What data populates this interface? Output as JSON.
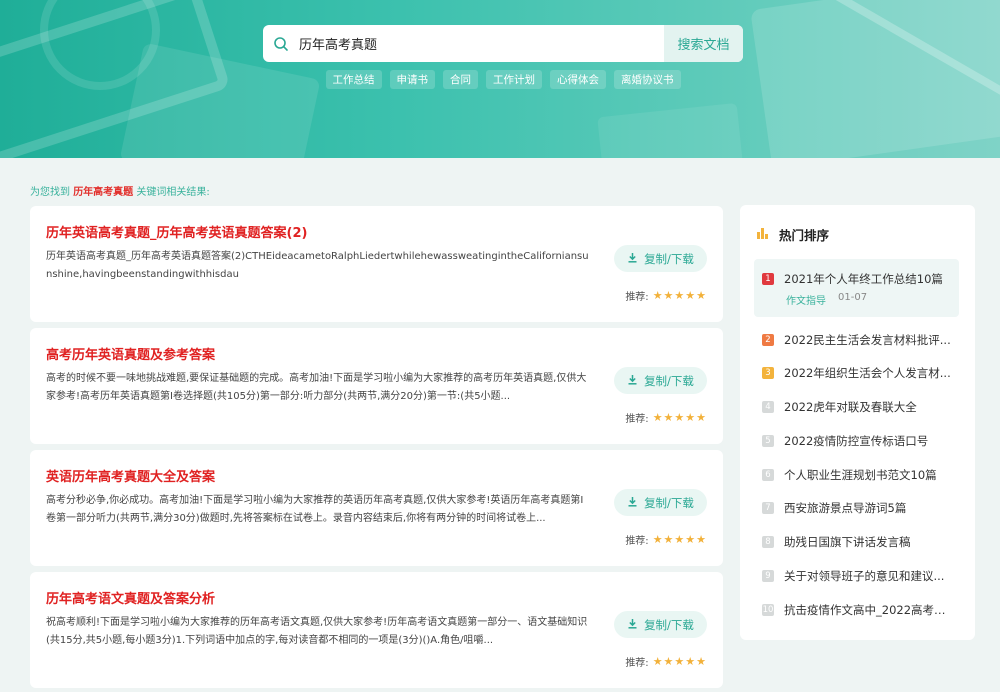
{
  "search": {
    "value": "历年高考真题",
    "button_label": "搜索文档"
  },
  "tags": [
    "工作总结",
    "申请书",
    "合同",
    "工作计划",
    "心得体会",
    "离婚协议书"
  ],
  "result_note": {
    "prefix": "为您找到",
    "keyword": "历年高考真题",
    "suffix": "关键词相关结果:"
  },
  "results": [
    {
      "title": "历年英语高考真题_历年高考英语真题答案(2)",
      "desc": "历年英语高考真题_历年高考英语真题答案(2)CTHEideacametoRalphLiedertwhilehewassweatingintheCaliforniansunshine,havingbeenstandingwithhisdau",
      "download_label": "复制/下载",
      "rating_label": "推荐:",
      "stars": "★★★★★"
    },
    {
      "title": "高考历年英语真题及参考答案",
      "desc": "高考的时候不要一味地挑战难题,要保证基础题的完成。高考加油!下面是学习啦小编为大家推荐的高考历年英语真题,仅供大家参考!高考历年英语真题第Ⅰ卷选择题(共105分)第一部分:听力部分(共两节,满分20分)第一节:(共5小题...",
      "download_label": "复制/下载",
      "rating_label": "推荐:",
      "stars": "★★★★★"
    },
    {
      "title": "英语历年高考真题大全及答案",
      "desc": "高考分秒必争,你必成功。高考加油!下面是学习啦小编为大家推荐的英语历年高考真题,仅供大家参考!英语历年高考真题第Ⅰ卷第一部分听力(共两节,满分30分)做题时,先将答案标在试卷上。录音内容结束后,你将有两分钟的时间将试卷上...",
      "download_label": "复制/下载",
      "rating_label": "推荐:",
      "stars": "★★★★★"
    },
    {
      "title": "历年高考语文真题及答案分析",
      "desc": "祝高考顺利!下面是学习啦小编为大家推荐的历年高考语文真题,仅供大家参考!历年高考语文真题第一部分一、语文基础知识(共15分,共5小题,每小题3分)1.下列词语中加点的字,每对读音都不相同的一项是(3分)()A.角色/咀嚼...",
      "download_label": "复制/下载",
      "rating_label": "推荐:",
      "stars": "★★★★★"
    }
  ],
  "sidebar": {
    "title": "热门排序",
    "items": [
      {
        "num": "1",
        "text": "2021年个人年终工作总结10篇",
        "color": "#e0393e",
        "category": "作文指导",
        "date": "01-07"
      },
      {
        "num": "2",
        "text": "2022民主生活会发言材料批评...",
        "color": "#ef7a43"
      },
      {
        "num": "3",
        "text": "2022年组织生活会个人发言材...",
        "color": "#f3b33c"
      },
      {
        "num": "4",
        "text": "2022虎年对联及春联大全",
        "color": "#d6d9d9"
      },
      {
        "num": "5",
        "text": "2022疫情防控宣传标语口号",
        "color": "#d6d9d9"
      },
      {
        "num": "6",
        "text": "个人职业生涯规划书范文10篇",
        "color": "#d6d9d9"
      },
      {
        "num": "7",
        "text": "西安旅游景点导游词5篇",
        "color": "#d6d9d9"
      },
      {
        "num": "8",
        "text": "助残日国旗下讲话发言稿",
        "color": "#d6d9d9"
      },
      {
        "num": "9",
        "text": "关于对领导班子的意见和建议...",
        "color": "#d6d9d9"
      },
      {
        "num": "10",
        "text": "抗击疫情作文高中_2022高考热...",
        "color": "#d6d9d9"
      }
    ]
  },
  "colors": {
    "accent": "#2aa894",
    "title_red": "#e02222",
    "star": "#f2b13a"
  }
}
